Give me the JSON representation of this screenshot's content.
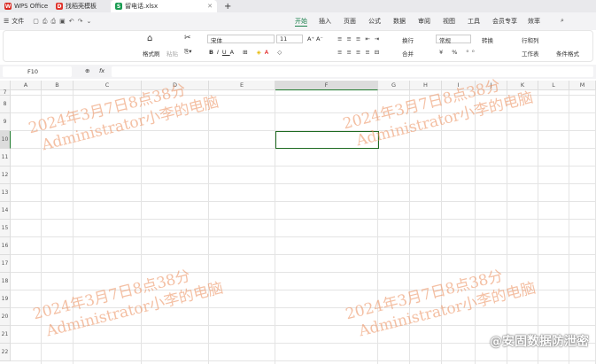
{
  "tabs": [
    {
      "label": "WPS Office",
      "icon": "wps-logo-icon",
      "color": "#d9251d"
    },
    {
      "label": "找稻壳模板",
      "icon": "docer-icon",
      "color": "#e0342c"
    },
    {
      "label": "留电话.xlsx",
      "icon": "spreadsheet-icon",
      "color": "#1a9c52"
    }
  ],
  "menu": {
    "file": "文件",
    "items": [
      "开始",
      "插入",
      "页面",
      "公式",
      "数据",
      "审阅",
      "视图",
      "工具",
      "会员专享",
      "效率"
    ],
    "active": "开始"
  },
  "ribbon": {
    "format_painter": "格式刷",
    "paste": "粘贴",
    "font": "宋体",
    "size": "11",
    "wrap": "换行",
    "merge": "合并",
    "number_format": "常规",
    "convert": "转换",
    "row_col": "行和列",
    "sheet": "工作表",
    "cond_format": "条件格式"
  },
  "formula_bar": {
    "cell_ref": "F10",
    "fx": "fx",
    "value": ""
  },
  "columns": [
    "A",
    "B",
    "C",
    "D",
    "E",
    "F",
    "G",
    "H",
    "I",
    "J",
    "K",
    "L",
    "M"
  ],
  "rows": [
    "7",
    "8",
    "9",
    "10",
    "11",
    "12",
    "13",
    "14",
    "15",
    "16",
    "17",
    "18",
    "19",
    "20",
    "21",
    "22"
  ],
  "selected": {
    "column": "F",
    "row": "10"
  },
  "watermark": {
    "line1": "2024年3月7日8点38分",
    "line2": "Administrator小李的电脑"
  },
  "brand": "@安固数据防泄密",
  "accent": "#1a7f4b"
}
